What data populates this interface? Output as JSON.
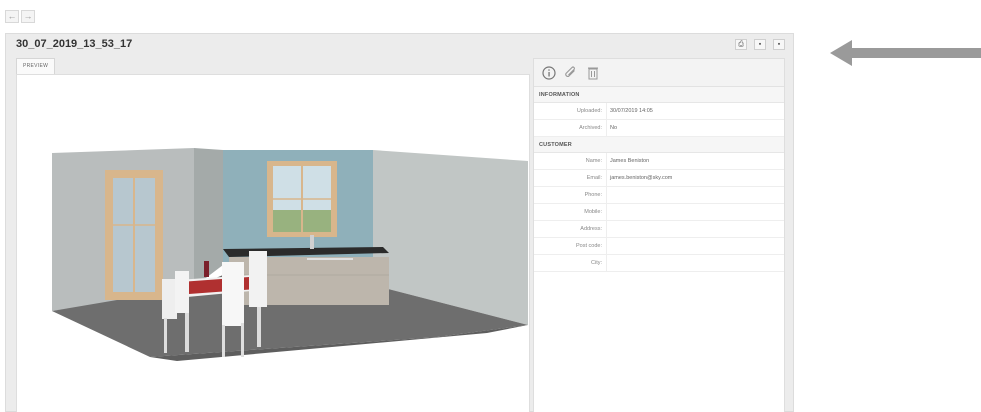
{
  "nav": {
    "back_icon": "←",
    "forward_icon": "→"
  },
  "panel": {
    "title": "30_07_2019_13_53_17",
    "actions": [
      {
        "icon": "print-icon",
        "glyph": "⎙"
      },
      {
        "icon": "folder-icon",
        "glyph": "▪"
      },
      {
        "icon": "export-icon",
        "glyph": "▪"
      }
    ]
  },
  "preview": {
    "tab_label": "PREVIEW"
  },
  "info": {
    "tools": [
      "info-icon",
      "paperclip-icon",
      "trash-icon"
    ],
    "sections": [
      {
        "header": "INFORMATION",
        "rows": [
          {
            "label": "Uploaded:",
            "value": "30/07/2019 14:05"
          },
          {
            "label": "Archived:",
            "value": "No"
          }
        ]
      },
      {
        "header": "CUSTOMER",
        "rows": [
          {
            "label": "Name:",
            "value": "James Beniston"
          },
          {
            "label": "Email:",
            "value": "james.beniston@sky.com"
          },
          {
            "label": "Phone:",
            "value": ""
          },
          {
            "label": "Mobile:",
            "value": ""
          },
          {
            "label": "Address:",
            "value": ""
          },
          {
            "label": "Post code:",
            "value": ""
          },
          {
            "label": "City:",
            "value": ""
          }
        ]
      }
    ]
  },
  "colors": {
    "arrow": "#9a9a9a",
    "back_wall": "#8fb0ba",
    "floor": "#6e6e6e"
  }
}
